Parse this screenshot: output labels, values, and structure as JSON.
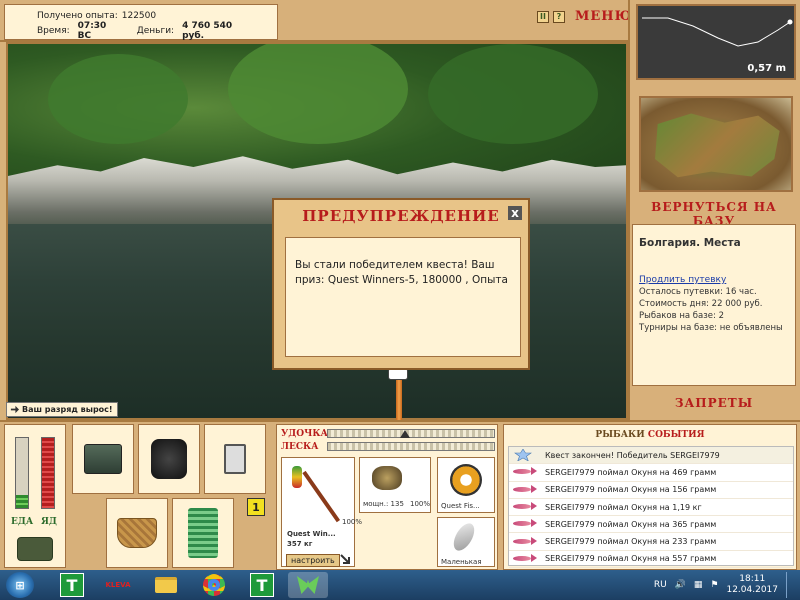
{
  "top": {
    "experience_label": "Получено опыта:",
    "experience_value": "122500",
    "time_label": "Время:",
    "time_value": "07:30 ВС",
    "money_label": "Деньги:",
    "money_value": "4 760 540 руб.",
    "pause_label": "II",
    "help_label": "?",
    "menu_label": "МЕНЮ"
  },
  "depth": {
    "value": "0,57 m"
  },
  "right": {
    "return_base": "ВЕРНУТЬСЯ НА БАЗУ",
    "place": "Болгария. Места",
    "extend_trip": "Продлить путевку",
    "trip_left": "Осталось путевки: 16 час.",
    "day_cost": "Стоимость дня: 22 000 руб.",
    "anglers": "Рыбаков на базе: 2",
    "tournaments": "Турниры на базе: не объявлены",
    "bans": "ЗАПРЕТЫ"
  },
  "scene": {
    "rank_message": "Ваш разряд вырос!"
  },
  "dialog": {
    "title": "ПРЕДУПРЕЖДЕНИЕ",
    "close": "x",
    "body": "Вы стали победителем квеста! Ваш приз: Quest Winners-5, 180000 , Опыта"
  },
  "meters": {
    "food_label": "ЕДА",
    "bait_label": "ЯД",
    "food_level": 0.18,
    "bait_level": 1.0
  },
  "level_badge": "1",
  "gear": {
    "rod_label": "УДОЧКА",
    "line_label": "ЛЕСКА",
    "rod_name": "Quest Win...",
    "rod_weight": "357 кг",
    "rod_condition": "100%",
    "reel_power": "мощн.: 135",
    "reel_condition": "100%",
    "line_name": "Quest Fis...",
    "lure_name": "Маленькая",
    "configure": "настроить"
  },
  "events": {
    "title_a": "РЫБАКИ",
    "title_b": "СОБЫТИЯ",
    "items": [
      "Квест закончен! Победитель SERGEI7979",
      "SERGEI7979 поймал Окуня на 469 грамм",
      "SERGEI7979 поймал Окуня на 156 грамм",
      "SERGEI7979 поймал Окуня на 1,19 кг",
      "SERGEI7979 поймал Окуня на 365 грамм",
      "SERGEI7979 поймал Окуня на 233 грамм",
      "SERGEI7979 поймал Окуня на 557 грамм"
    ]
  },
  "taskbar": {
    "start": "⊞",
    "app_t": "T",
    "app_kleva": "KLEVA",
    "lang": "RU",
    "time": "18:11",
    "date": "12.04.2017"
  },
  "colors": {
    "accent_red": "#b71c1c",
    "panel_bg": "#fff3d6",
    "wood": "#d7b07a"
  }
}
